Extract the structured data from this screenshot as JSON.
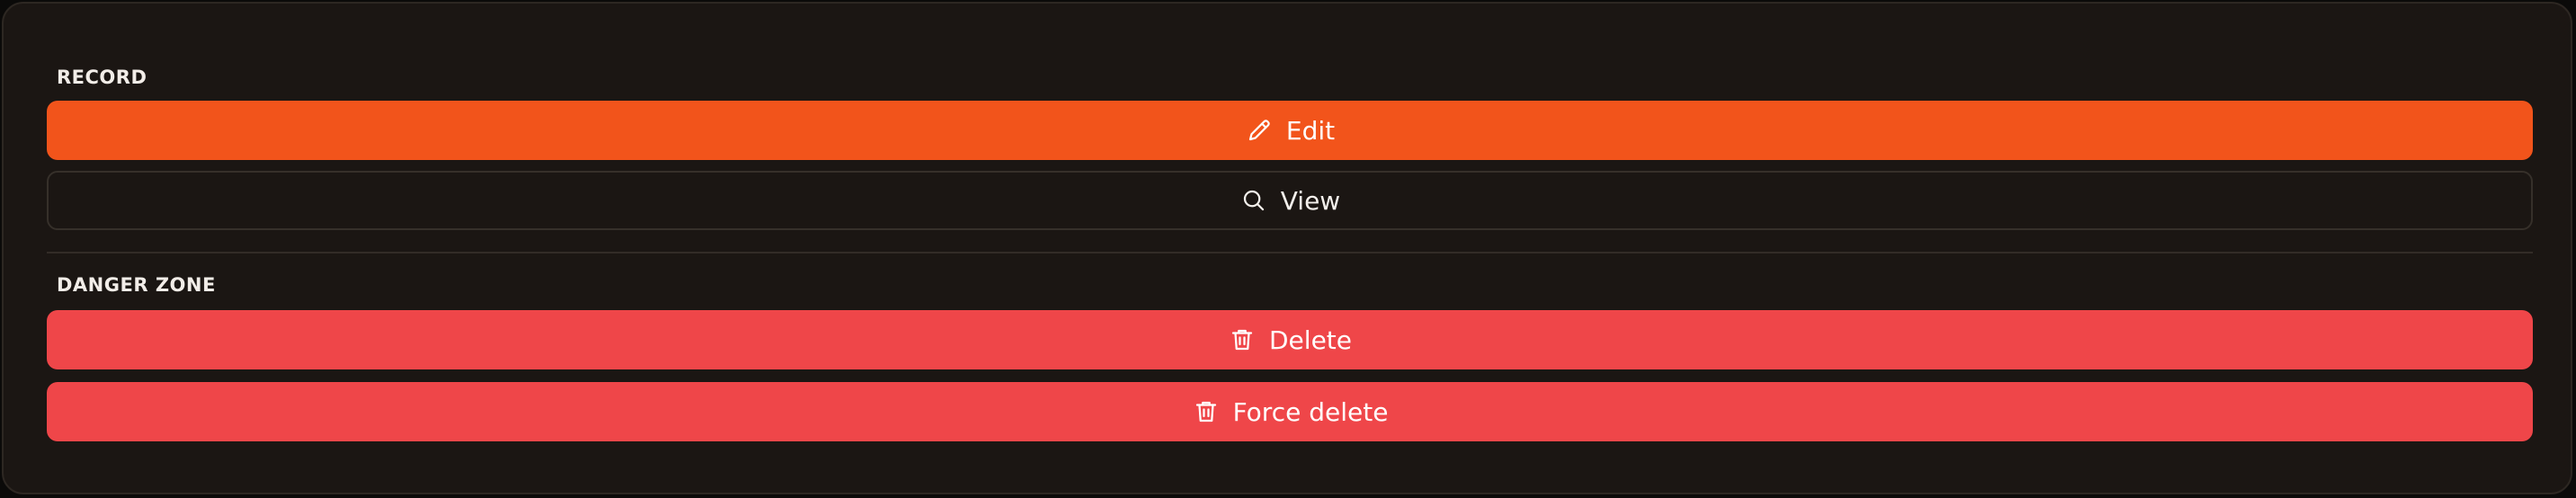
{
  "sections": {
    "record": {
      "label": "RECORD",
      "edit_label": "Edit",
      "edit_icon": "pencil-icon",
      "view_label": "View",
      "view_icon": "search-icon"
    },
    "danger": {
      "label": "DANGER ZONE",
      "delete_label": "Delete",
      "delete_icon": "trash-icon",
      "force_delete_label": "Force delete",
      "force_delete_icon": "trash-icon"
    }
  },
  "colors": {
    "panel_bg": "#1b1613",
    "primary": "#f2541b",
    "danger": "#ef4649",
    "text": "#ffffff"
  }
}
